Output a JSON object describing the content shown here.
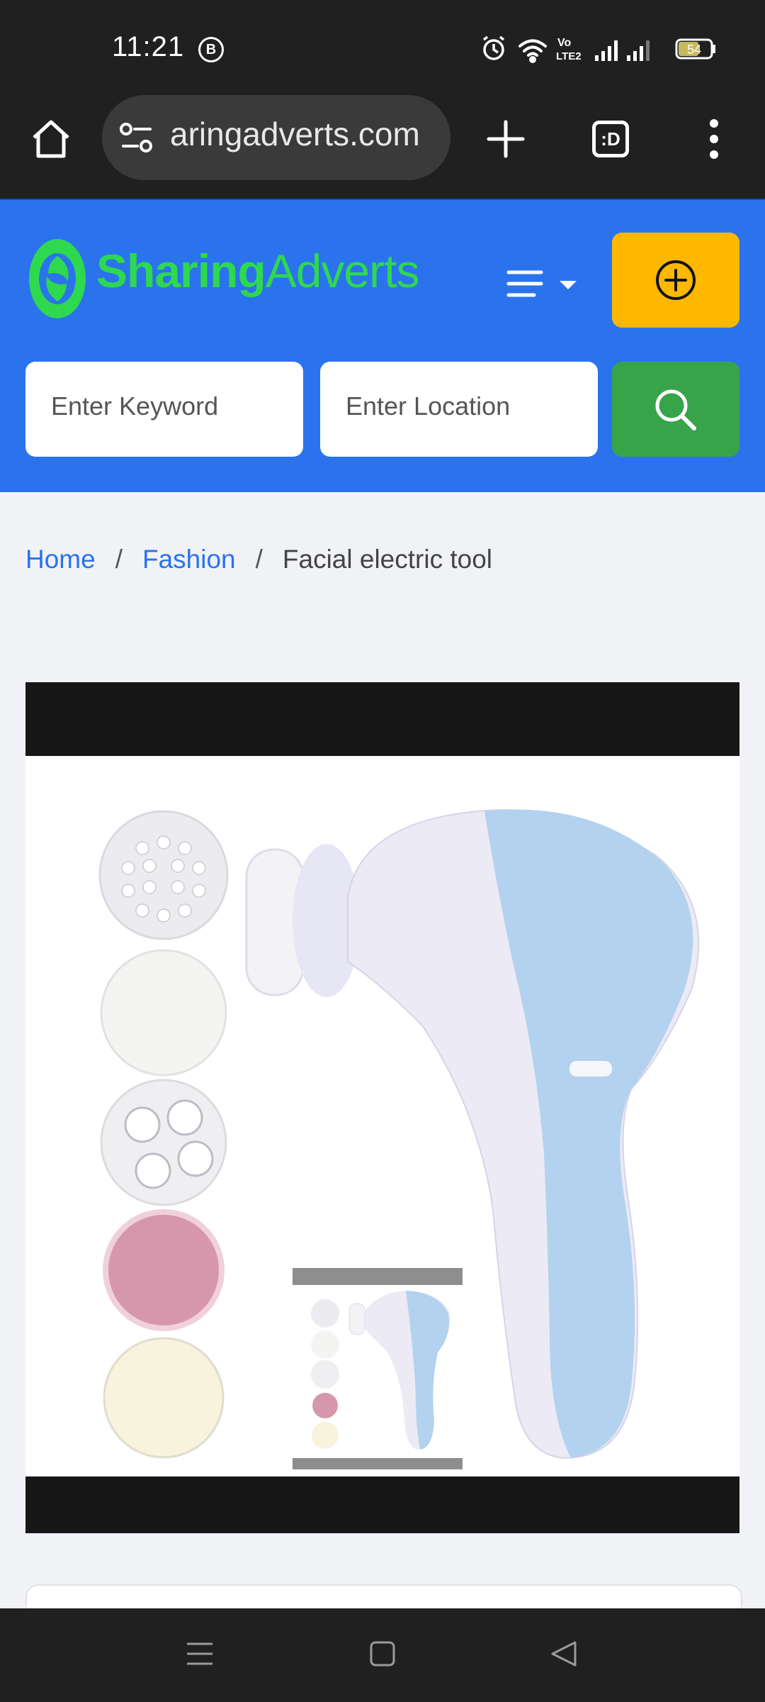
{
  "status_bar": {
    "time": "11:21",
    "notification_badge": "B",
    "battery_level": "54",
    "network_label_top": "Vo",
    "network_label_bottom": "LTE2",
    "icons": [
      "alarm-icon",
      "wifi-icon",
      "volte-icon",
      "signal-icon",
      "signal-icon",
      "battery-icon"
    ]
  },
  "browser": {
    "url": "aringadverts.com",
    "tab_switcher_label": ":D",
    "icons": [
      "home-icon",
      "site-settings-icon",
      "new-tab-icon",
      "tab-switcher-icon",
      "overflow-menu-icon"
    ]
  },
  "header": {
    "logo_bold": "Sharing",
    "logo_light": "Adverts",
    "search": {
      "keyword_placeholder": "Enter Keyword",
      "location_placeholder": "Enter Location"
    },
    "icons": [
      "logo-icon",
      "menu-icon",
      "add-circle-icon",
      "search-icon"
    ],
    "colors": {
      "background": "#2a73ed",
      "logo": "#2ed84f",
      "post_button": "#ffb800",
      "search_button": "#37a44a"
    }
  },
  "breadcrumb": {
    "items": [
      "Home",
      "Fashion"
    ],
    "separator": "/",
    "current": "Facial electric tool"
  },
  "gallery": {
    "image_subject": "facial electric cleansing brush with attachments",
    "icons": [
      "product-image",
      "thumbnail-image"
    ]
  },
  "nav_bar": {
    "icons": [
      "recent-apps-icon",
      "home-nav-icon",
      "back-icon"
    ]
  }
}
